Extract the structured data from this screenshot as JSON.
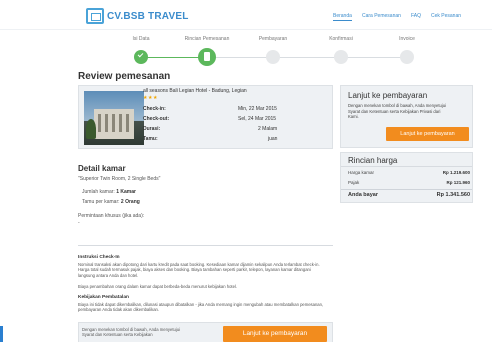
{
  "header": {
    "logo_text": "CV.BSB TRAVEL",
    "nav": [
      {
        "label": "Beranda",
        "active": true
      },
      {
        "label": "Cara Pemesanan",
        "active": false
      },
      {
        "label": "FAQ",
        "active": false
      },
      {
        "label": "Cek Pesanan",
        "active": false
      }
    ]
  },
  "steps": [
    {
      "label": "Isi Data",
      "state": "done",
      "icon": "check-icon"
    },
    {
      "label": "Rincian Pemesanan",
      "state": "current",
      "icon": "document-icon"
    },
    {
      "label": "Pembayaran",
      "state": "pending"
    },
    {
      "label": "Konfirmasi",
      "state": "pending"
    },
    {
      "label": "Invoice",
      "state": "pending"
    }
  ],
  "page_title": "Review pemesanan",
  "hotel": {
    "name": "all seasons Bali Legian Hotel - Badung, Legian",
    "stars": "★★★",
    "details": [
      {
        "label": "Check-in:",
        "value": "Min, 22 Mar 2015"
      },
      {
        "label": "Check-out:",
        "value": "Sel, 24 Mar 2015"
      },
      {
        "label": "Durasi:",
        "value": "2 Malam"
      },
      {
        "label": "Tamu:",
        "value": "juan"
      }
    ]
  },
  "continue_panel": {
    "title": "Lanjut ke pembayaran",
    "text": "Dengan menekan tombol di bawah, Anda menyetujui Syarat dan Ketentuan serta Kebijakan Privasi dari Kami.",
    "button_label": "Lanjut ke pembayaran"
  },
  "price_panel": {
    "title": "Rincian harga",
    "rows": [
      {
        "label": "Harga kamar",
        "value": "Rp 1.219.600"
      },
      {
        "label": "Pajak",
        "value": "Rp 121.960"
      }
    ],
    "total_label": "Anda bayar",
    "total_value": "Rp 1.341.560"
  },
  "room": {
    "title": "Detail kamar",
    "name": "\"Superior Twin Room, 2 Single Beds\"",
    "rooms_label": "Jumlah kamar:",
    "rooms_value": "1 Kamar",
    "guests_label": "Tamu per kamar:",
    "guests_value": "2 Orang",
    "special_label": "Permintaan khusus (jika ada):",
    "special_value": "-"
  },
  "policy": {
    "checkin_title": "Instruksi Check-In",
    "checkin_text": "Nominal transaksi akan dipotong dari kartu kredit pada saat booking. Kesediaan kamar dijamin sekalipun Anda terlambat check-in. Harga total sudah termasuk pajak, biaya akses dan booking. Biaya tambahan seperti parkir, telepon, layanan kamar ditangani langsung antara Anda dan hotel.",
    "payment_text": "Biaya penambahan orang dalam kamar dapat berbeda-beda menurut kebijakan hotel.",
    "cancel_title": "Kebijakan Pembatalan",
    "cancel_text": "Biaya ini tidak dapat dikembalikan, dilunasi ataupun dibatalkan - jika Anda memang ingin mengubah atau membatalkan pemesanan, pembayaran Anda tidak akan dikembalikan."
  },
  "bottom_bar": {
    "text": "Dengan menekan tombol di bawah, Anda menyetujui Syarat dan Ketentuan serta Kebijakan",
    "button_label": "Lanjut ke pembayaran"
  },
  "colors": {
    "accent": "#3b8ccc",
    "success": "#5cb85c",
    "cta": "#f28c1e",
    "panel": "#eef1f4"
  }
}
